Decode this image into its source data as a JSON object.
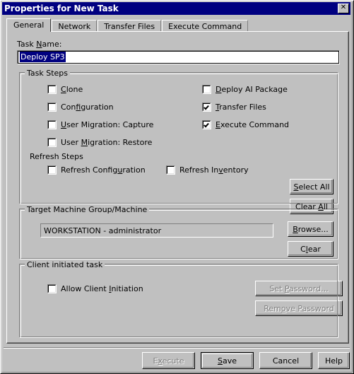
{
  "window": {
    "title": "Properties for New Task",
    "close_label": "✕"
  },
  "tabs": [
    {
      "label": "General",
      "active": true
    },
    {
      "label": "Network",
      "active": false
    },
    {
      "label": "Transfer Files",
      "active": false
    },
    {
      "label": "Execute Command",
      "active": false
    }
  ],
  "task_name": {
    "label_pre": "Task ",
    "label_accel": "N",
    "label_post": "ame:",
    "value": "Deploy SP3",
    "selected": true
  },
  "task_steps": {
    "group_title": "Task Steps",
    "left_items": [
      {
        "pre": "",
        "accel": "C",
        "post": "lone",
        "checked": false
      },
      {
        "pre": "Con",
        "accel": "f",
        "post": "iguration",
        "checked": false
      },
      {
        "pre": "",
        "accel": "U",
        "post": "ser Migration: Capture",
        "checked": false
      },
      {
        "pre": "User ",
        "accel": "M",
        "post": "igration: Restore",
        "checked": false
      }
    ],
    "right_items": [
      {
        "pre": "",
        "accel": "D",
        "post": "eploy AI Package",
        "checked": false
      },
      {
        "pre": "",
        "accel": "T",
        "post": "ransfer Files",
        "checked": true
      },
      {
        "pre": "",
        "accel": "E",
        "post": "xecute Command",
        "checked": true
      }
    ],
    "refresh_title": "Refresh Steps",
    "refresh_items": [
      {
        "pre": "Refresh Config",
        "accel": "u",
        "post": "ration",
        "checked": false
      },
      {
        "pre": "Refresh In",
        "accel": "v",
        "post": "entory",
        "checked": false
      }
    ],
    "select_all": {
      "pre": "",
      "accel": "S",
      "post": "elect All"
    },
    "clear_all": {
      "pre": "Clear ",
      "accel": "A",
      "post": "ll"
    }
  },
  "target_machine": {
    "group_title": "Target Machine Group/Machine",
    "value": "WORKSTATION - administrator",
    "browse": {
      "pre": "",
      "accel": "B",
      "post": "rowse..."
    },
    "clear": {
      "pre": "C",
      "accel": "l",
      "post": "ear"
    }
  },
  "client_task": {
    "group_title": "Client initiated task",
    "allow_checkbox": {
      "pre": "Allow Client ",
      "accel": "I",
      "post": "nitiation",
      "checked": false
    },
    "set_password": {
      "pre": "Set ",
      "accel": "P",
      "post": "assword...",
      "disabled": true
    },
    "remove_password": {
      "pre": "Rem",
      "accel": "o",
      "post": "ve Password",
      "disabled": true
    }
  },
  "footer": {
    "execute": {
      "pre": "E",
      "accel": "x",
      "post": "ecute",
      "disabled": true
    },
    "save": {
      "pre": "",
      "accel": "S",
      "post": "ave",
      "default": true
    },
    "cancel": {
      "pre": "Cancel",
      "accel": "",
      "post": ""
    },
    "help": {
      "pre": "Help",
      "accel": "",
      "post": ""
    }
  },
  "colors": {
    "face": "#c0c0c0",
    "titlebar": "#000080",
    "highlight": "#000080",
    "window": "#ffffff",
    "disabled_text": "#808080"
  }
}
